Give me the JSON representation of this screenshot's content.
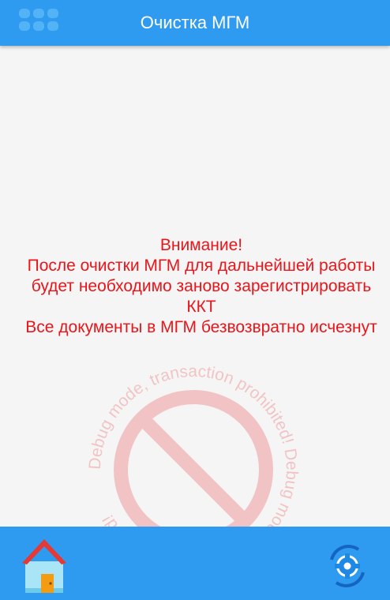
{
  "header": {
    "title": "Очистка МГМ",
    "menu_icon": "dots-grid-icon"
  },
  "warning": {
    "lines": [
      "Внимание!",
      "После очистки МГМ для дальнейшей работы",
      "будет необходимо заново зарегистрировать",
      "ККТ",
      "Все документы в МГМ безвозвратно исчезнут"
    ],
    "color": "#e8161b"
  },
  "watermark": {
    "text": "Debug mode, transaction prohibited! Debug mode, transaction prohibited! ",
    "icon": "prohibited-icon",
    "color": "#e8161b"
  },
  "footer": {
    "home_icon": "home-icon",
    "settings_icon": "gear-icon"
  },
  "colors": {
    "accent": "#2e9bf0",
    "background": "#f5f5f5"
  }
}
